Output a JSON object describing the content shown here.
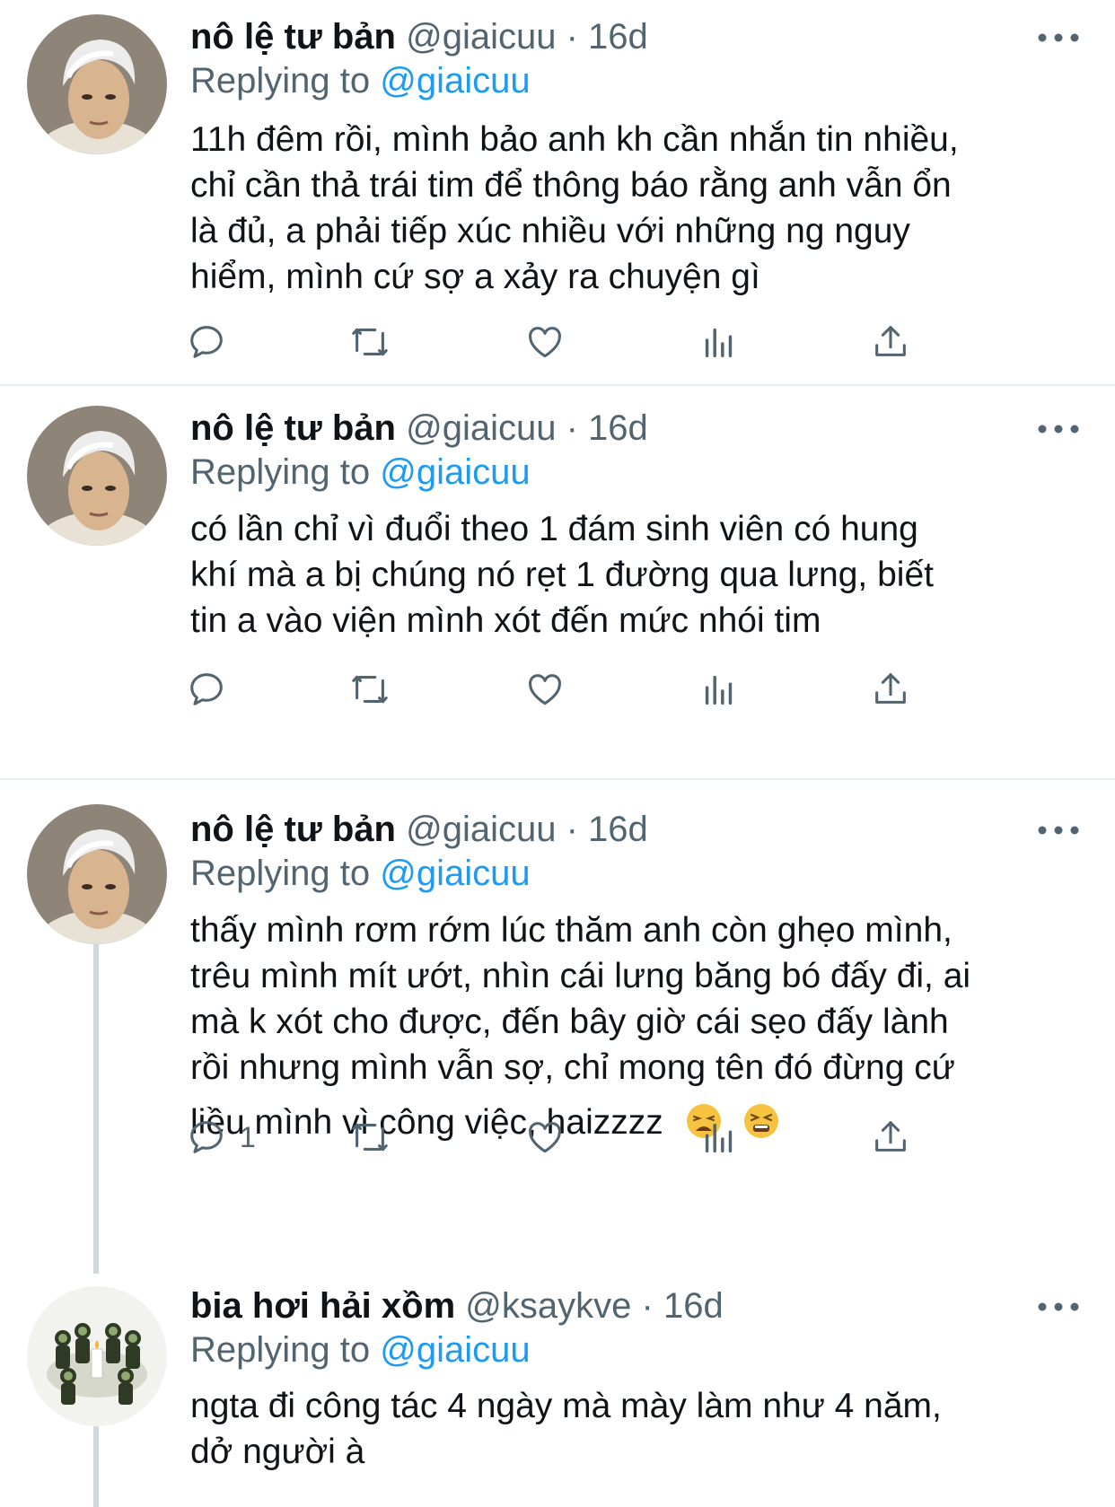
{
  "tweets": [
    {
      "name": "nô lệ tư bản",
      "handle": "@giaicuu",
      "dot": "·",
      "time": "16d",
      "replying_prefix": "Replying to ",
      "replying_to": "@giaicuu",
      "lines": [
        "11h đêm rồi, mình bảo anh kh cần nhắn tin nhiều,",
        "chỉ cần thả trái tim để thông báo rằng anh vẫn ổn",
        "là đủ, a phải tiếp xúc nhiều với những ng nguy",
        "hiểm, mình cứ sợ a xảy ra chuyện gì"
      ],
      "reply_count": ""
    },
    {
      "name": "nô lệ tư bản",
      "handle": "@giaicuu",
      "dot": "·",
      "time": "16d",
      "replying_prefix": "Replying to ",
      "replying_to": "@giaicuu",
      "lines": [
        "có lần chỉ vì đuổi theo 1 đám sinh viên có hung",
        "khí mà a bị chúng nó rẹt 1 đường qua lưng, biết",
        "tin a vào viện mình xót đến mức nhói tim"
      ],
      "reply_count": ""
    },
    {
      "name": "nô lệ tư bản",
      "handle": "@giaicuu",
      "dot": "·",
      "time": "16d",
      "replying_prefix": "Replying to ",
      "replying_to": "@giaicuu",
      "lines": [
        "thấy mình rơm rớm lúc thăm anh còn ghẹo mình,",
        "trêu mình mít ướt, nhìn cái lưng băng bó đấy đi, ai",
        "mà k xót cho được, đến bây giờ cái sẹo đấy lành",
        "rồi nhưng mình vẫn sợ, chỉ mong tên đó đừng cứ",
        "liều mình vì công việc, haizzzz"
      ],
      "reply_count": "1"
    },
    {
      "name": "bia hơi hải xồm",
      "handle": "@ksaykve",
      "dot": "·",
      "time": "16d",
      "replying_prefix": "Replying to ",
      "replying_to": "@giaicuu",
      "lines": [
        "ngta đi công tác 4 ngày mà mày làm như 4 năm,",
        "dở người à"
      ]
    }
  ],
  "icons": {
    "reply": "reply-icon",
    "retweet": "retweet-icon",
    "like": "heart-icon",
    "analytics": "analytics-icon",
    "share": "share-icon",
    "more": "more-icon",
    "emoji_1": "weary-face-emoji",
    "emoji_2": "tired-face-emoji"
  },
  "colors": {
    "text": "#0f1419",
    "secondary": "#536471",
    "mention": "#1d9bf0",
    "separator": "#e6ecf0",
    "thread_line": "#cfd9de"
  }
}
